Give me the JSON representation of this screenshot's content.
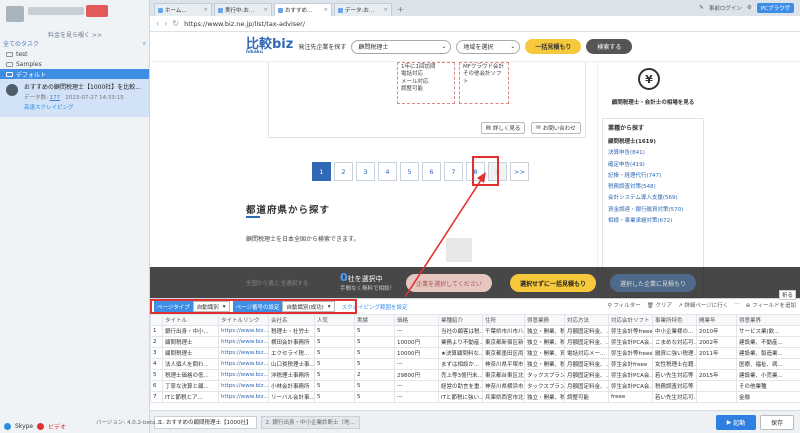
{
  "sidebar": {
    "link": "料金を見ら覗く >>",
    "all_tasks": "全てのタスク",
    "tree": [
      {
        "label": "test"
      },
      {
        "label": "Samples"
      },
      {
        "label": "デフォルト"
      }
    ],
    "task": {
      "title": "おすすめの顧問税理士【1000社】を比較...",
      "data_label": "データ数:",
      "data_count": "177",
      "timestamp": "2023-07-27 14:33:15",
      "status": "高速スクレイピング"
    },
    "footer": {
      "skype": "Skype",
      "help": "ビデオ",
      "version": "バージョン: 4.0.2-beta.2"
    }
  },
  "browser": {
    "tabs": [
      {
        "label": "ホーム..."
      },
      {
        "label": "実行中:お..."
      },
      {
        "label": "おすすめ..."
      },
      {
        "label": "データ:お..."
      }
    ],
    "top_right": {
      "login": "事前ログイン",
      "pc": "PCブラウザ"
    },
    "url": "https://www.biz.ne.jp/list/tax-adviser/"
  },
  "site": {
    "logo_main": "比較biz",
    "logo_sub": "hikaku",
    "order_label": "発注先企業を探す",
    "category_value": "顧問税理士",
    "area_value": "地域を選択",
    "btn_estimate": "一括見積もり",
    "btn_search": "検索する",
    "card_lines_a": [
      "1年に1回訪問",
      "電話対応",
      "メール対応",
      "調整可能"
    ],
    "card_lines_b": [
      "MFクラウド会計",
      "その他会計ソフト"
    ],
    "btn_detail": "詳しく見る",
    "btn_contact": "お問い合わせ",
    "pages": [
      "1",
      "2",
      "3",
      "4",
      "5",
      "6",
      "7",
      "8",
      ">",
      ">>"
    ],
    "section_title": "都道府県から探す",
    "section_desc": "顧問税理士を日本全国から検索できます。",
    "price_title": "顧問税理士・会計士の相場を見る",
    "category_box_title": "業種から探す",
    "categories": [
      "顧問税理士(1619)",
      "決算申告(841)",
      "確定申告(419)",
      "記帳・経理代行(747)",
      "税務調査対策(548)",
      "会計システム導入支援(569)",
      "資金調達・銀行融資対策(570)",
      "相続・事業承継対策(672)"
    ]
  },
  "floatbar": {
    "faded_text": "全国から選ぶ 全選択する",
    "count": "0",
    "count_suffix": "社を選択中",
    "sub": "手間なく無料で相談！",
    "btn_select": "企業を選択してください",
    "btn_bulk": "選択せずに一括見積もり",
    "btn_faded": "選択した企業に見積もり"
  },
  "panel": {
    "fold": "折る",
    "page_type_label": "ページタイプ",
    "page_type_value": "自動識別",
    "page_num_label": "ページ番号の設定",
    "page_num_value": "自動識別(成功)",
    "scrape_link": "スクレイピング範囲を設定",
    "tools": [
      "フィルター",
      "クリア",
      "詳細ページに行く",
      "フィールドを追加"
    ],
    "columns": [
      "",
      "タイトル",
      "タイトルリンク",
      "会社名",
      "人気",
      "実績",
      "価格",
      "業種紹介",
      "住所",
      "得意業務",
      "対応方法",
      "対応会計ソフト",
      "事業所特色",
      "開業年",
      "得意業界"
    ],
    "rows": [
      [
        "1",
        "銀行出身・中小...",
        "https://www.biz...",
        "税理士・社労士",
        "5",
        "5",
        "—",
        "当社の顧客は税...",
        "千葉県市川市八...",
        "独立・開業、税...",
        "月額固定料金、...",
        "弥生会計等freee",
        "中小企業様の...",
        "2010年",
        "サービス業(飲..."
      ],
      [
        "2",
        "顧問税理士",
        "https://www.biz...",
        "横田会計事務所",
        "5",
        "5",
        "10000円",
        "業務より不動産...",
        "東京都新宿区新...",
        "独立・開業、税...",
        "月額固定料金、...",
        "弥生会計PCA会...",
        "こまめな対応可...",
        "2002年",
        "建設業、不動産..."
      ],
      [
        "3",
        "顧問税理士",
        "https://www.biz...",
        "エクセライ税...",
        "5",
        "5",
        "10000円",
        "★決算顧問料な...",
        "東京都墨田区両...",
        "独立・開業、資...",
        "電話対応メー...",
        "弥生会計等freee",
        "融資に強い税理...",
        "2011年",
        "建設業、製造業..."
      ],
      [
        "4",
        "法人個人を問わ...",
        "https://www.biz...",
        "山口貧税理士事...",
        "5",
        "5",
        "—",
        "まずは相談か...",
        "神奈川県平塚市...",
        "独立・開業、税...",
        "月額固定料金、...",
        "弥生会計freee",
        "女性税理士在籍...",
        "",
        "医療、福祉、病..."
      ],
      [
        "5",
        "税理士価格の低...",
        "https://www.biz...",
        "沖税理士事務所",
        "5",
        "2",
        "29800円",
        "売上等3億円未...",
        "東京都台東区北...",
        "タックスプラン...",
        "月額固定料金、...",
        "弥生会計PCA会...",
        "若い先生対応等",
        "2015年",
        "建設業、小売業..."
      ],
      [
        "6",
        "丁寧な決算と顧...",
        "https://www.biz...",
        "小林会計事務所",
        "5",
        "5",
        "—",
        "経営の助言を重...",
        "神奈川県横浜市...",
        "タックスプラン...",
        "月額固定料金、...",
        "弥生会計PCA会...",
        "税務調査対応等",
        "",
        "その他業種"
      ],
      [
        "7",
        "ITと節税とア...",
        "https://www.biz...",
        "リーバル会計事...",
        "5",
        "5",
        "—",
        "ITと節税に強い...",
        "兵庫県西宮市北...",
        "独立・開業、税...",
        "調整可能",
        "freee",
        "若い先生対応可...",
        "",
        "金融"
      ]
    ]
  },
  "bottom": {
    "tab1": "1. おすすめの顧問税理士【1000社】",
    "tab2": "2. 銀行出身・中小企業診断士（地...",
    "run": "起動",
    "save": "保存"
  },
  "colors": {
    "accent": "#3e8ee6",
    "brand": "#2f69b5",
    "highlight": "#e03131",
    "yellow": "#f6c83c"
  }
}
